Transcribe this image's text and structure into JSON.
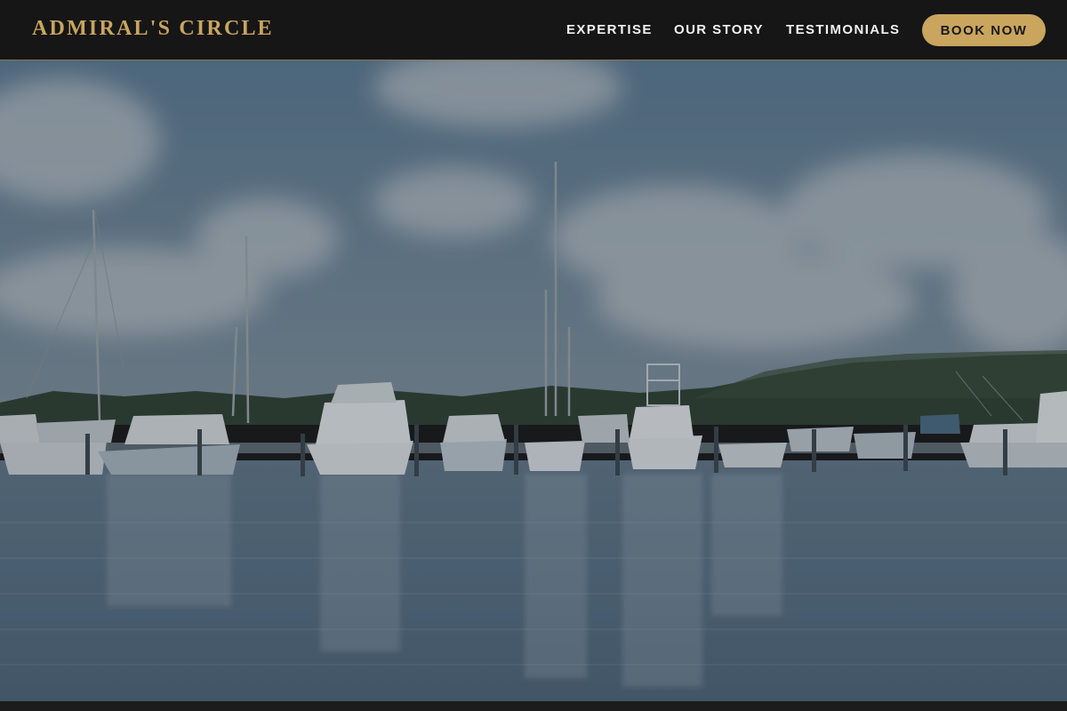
{
  "brand": {
    "name": "ADMIRAL'S CIRCLE",
    "color": "#c9a55e"
  },
  "nav": {
    "links": [
      {
        "label": "EXPERTISE"
      },
      {
        "label": "OUR STORY"
      },
      {
        "label": "TESTIMONIALS"
      }
    ],
    "cta_label": "BOOK NOW"
  },
  "hero": {
    "image_subject": "marina with moored yachts and sailboats under a cloudy sky",
    "overlay": "dark"
  },
  "colors": {
    "accent": "#c9a55e",
    "header_bg": "#161616",
    "nav_text": "#f2f2f2"
  }
}
